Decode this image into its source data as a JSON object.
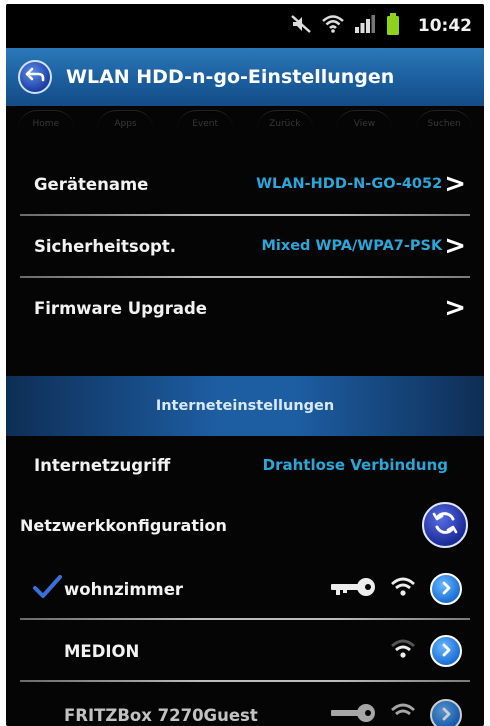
{
  "status_bar": {
    "time": "10:42",
    "icons": [
      "mute-icon",
      "wifi-icon",
      "signal-icon",
      "battery-icon"
    ]
  },
  "title_bar": {
    "title": "WLAN HDD-n-go-Einstellungen",
    "back_icon": "back-arrow-icon"
  },
  "ghost_toolbar": [
    "Home",
    "Apps",
    "Event",
    "Zurück",
    "View",
    "Suchen"
  ],
  "settings": [
    {
      "label": "Gerätename",
      "value": "WLAN-HDD-N-GO-4052",
      "chevron": ">"
    },
    {
      "label": "Sicherheitsopt.",
      "value": "Mixed WPA/WPA7-PSK",
      "chevron": ">"
    },
    {
      "label": "Firmware Upgrade",
      "value": "",
      "chevron": ">"
    }
  ],
  "internet_section": {
    "header": "Interneteinstellungen",
    "access_label": "Internetzugriff",
    "access_value": "Drahtlose Verbindung",
    "network_config_label": "Netzwerkkonfiguration"
  },
  "networks": [
    {
      "name": "wohnzimmer",
      "connected": true,
      "secured": true
    },
    {
      "name": "MEDION",
      "connected": false,
      "secured": false
    },
    {
      "name": "FRITZBox 7270Guest",
      "connected": false,
      "secured": true
    }
  ],
  "colors": {
    "accent_blue": "#2aa6d8",
    "title_bar": "#1a5c9c",
    "background": "#050505"
  }
}
